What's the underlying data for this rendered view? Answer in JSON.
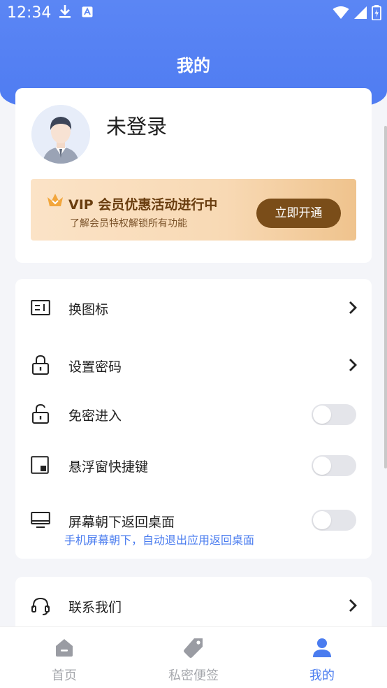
{
  "status_bar": {
    "time": "12:34"
  },
  "header": {
    "title": "我的"
  },
  "profile": {
    "login_status": "未登录",
    "vip": {
      "title": "VIP 会员优惠活动进行中",
      "subtitle": "了解会员特权解锁所有功能",
      "button": "立即开通"
    }
  },
  "settings": {
    "items": [
      {
        "label": "换图标",
        "control": "chevron",
        "icon": "icon-change-icon"
      },
      {
        "label": "设置密码",
        "control": "chevron",
        "icon": "lock-icon"
      },
      {
        "label": "免密进入",
        "control": "toggle",
        "on": false,
        "icon": "unlock-icon"
      },
      {
        "label": "悬浮窗快捷键",
        "control": "toggle",
        "on": false,
        "icon": "floating-window-icon"
      },
      {
        "label": "屏幕朝下返回桌面",
        "subtitle": "手机屏幕朝下，自动退出应用返回桌面",
        "control": "toggle",
        "on": false,
        "icon": "monitor-icon"
      }
    ]
  },
  "contact": {
    "label": "联系我们",
    "icon": "headset-icon"
  },
  "bottom_nav": {
    "items": [
      {
        "label": "首页",
        "icon": "home-icon",
        "active": false
      },
      {
        "label": "私密便签",
        "icon": "tag-icon",
        "active": false
      },
      {
        "label": "我的",
        "icon": "user-icon",
        "active": true
      }
    ]
  },
  "colors": {
    "header_blue": "#5b86f4",
    "accent_blue": "#4a7cef",
    "vip_brown": "#7a4d19"
  }
}
